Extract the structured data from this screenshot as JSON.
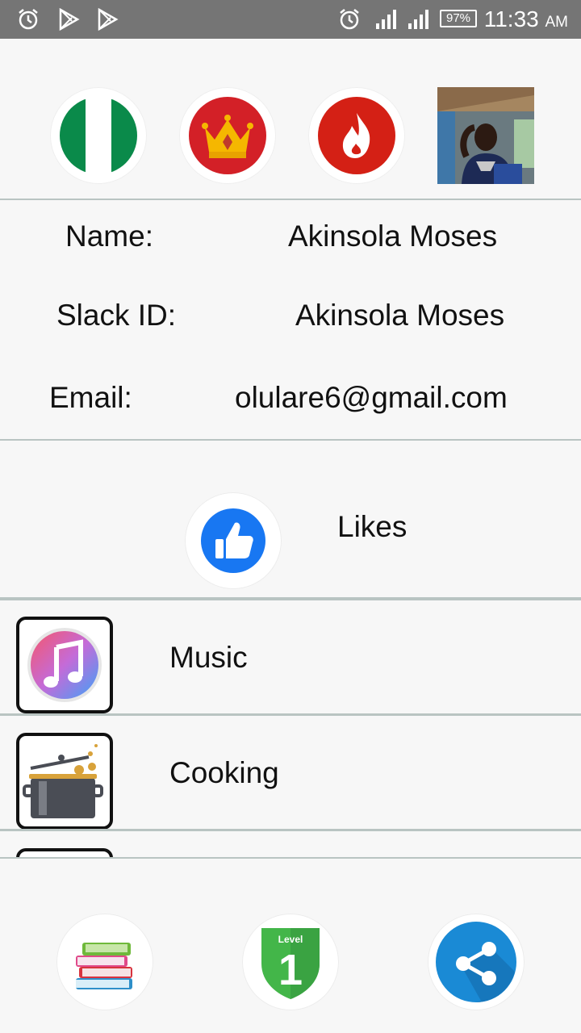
{
  "status_bar": {
    "time": "11:33",
    "ampm": "AM",
    "battery": "97%",
    "icons": [
      "alarm-icon",
      "play-store-icon",
      "play-store-icon",
      "alarm-icon",
      "signal-icon",
      "signal-icon",
      "battery-icon"
    ]
  },
  "badges": [
    "nigeria-flag-icon",
    "crown-icon",
    "fire-icon",
    "profile-photo"
  ],
  "profile": {
    "name_label": "Name:",
    "name_value": "Akinsola Moses",
    "slack_label": "Slack ID:",
    "slack_value": "Akinsola Moses",
    "email_label": "Email:",
    "email_value": "olulare6@gmail.com"
  },
  "likes": {
    "title": "Likes",
    "items": [
      {
        "label": "Music",
        "icon": "music-icon"
      },
      {
        "label": "Cooking",
        "icon": "cooking-pot-icon"
      }
    ]
  },
  "bottom_nav": [
    "books-icon",
    "level-1-shield-icon",
    "share-icon"
  ],
  "level_badge": {
    "text": "Level",
    "number": "1"
  },
  "colors": {
    "status_bar": "#757575",
    "divider": "#b9c4c2",
    "crown_red": "#d32027",
    "fire_red": "#d42015",
    "like_blue": "#1877f2",
    "share_blue": "#1a8ad5",
    "level_green": "#43b649"
  }
}
